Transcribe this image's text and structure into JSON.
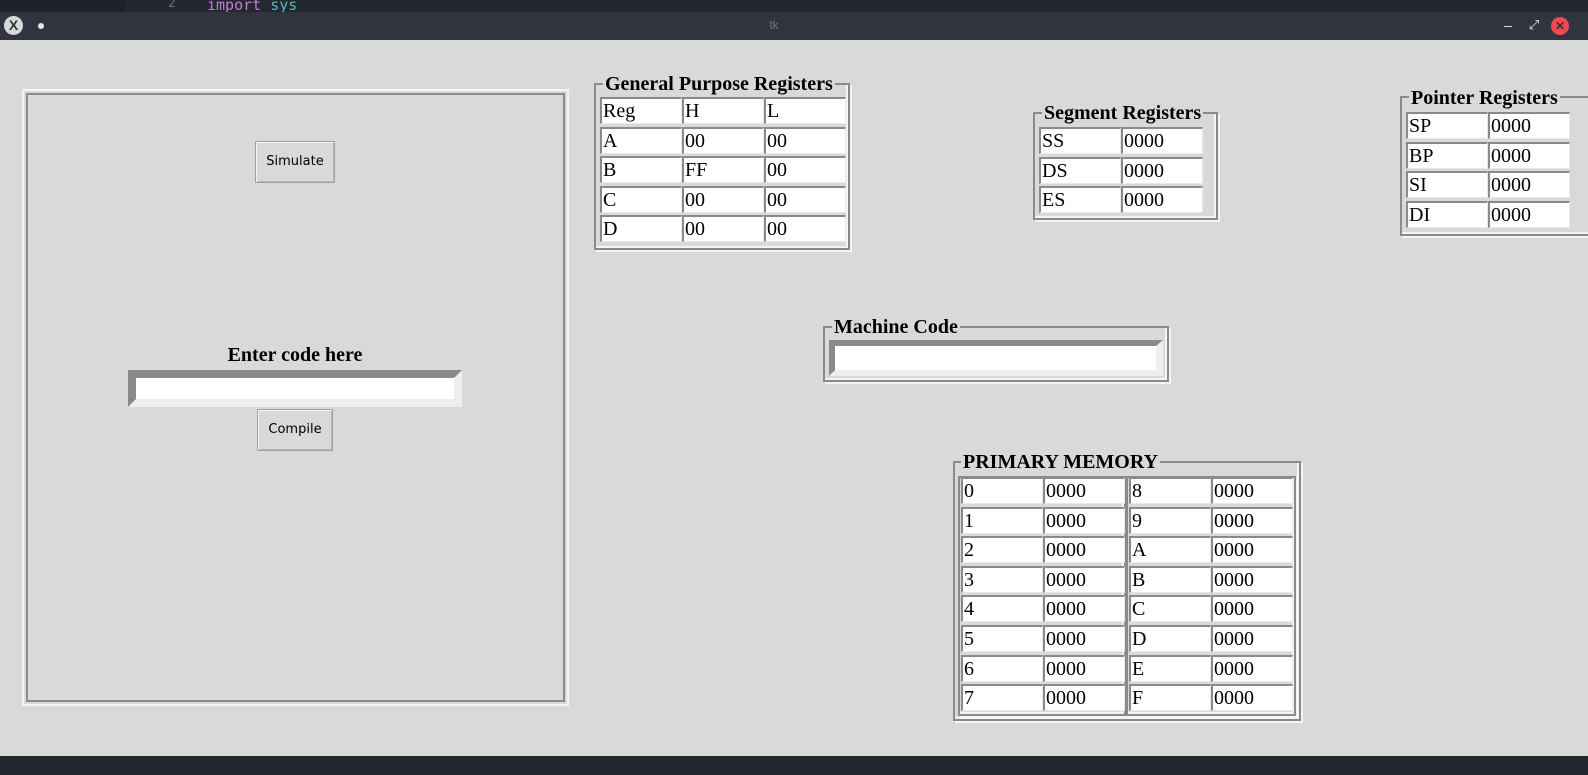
{
  "editor_behind": {
    "line_number": "2",
    "keyword": "import",
    "module": "sys"
  },
  "window": {
    "title": "tk"
  },
  "left_panel": {
    "simulate_label": "Simulate",
    "prompt": "Enter code here",
    "code_value": "",
    "compile_label": "Compile"
  },
  "gpr": {
    "title": "General Purpose Registers",
    "rows": [
      [
        "Reg",
        "H",
        "L"
      ],
      [
        "A",
        "00",
        "00"
      ],
      [
        "B",
        "FF",
        "00"
      ],
      [
        "C",
        "00",
        "00"
      ],
      [
        "D",
        "00",
        "00"
      ]
    ]
  },
  "segment": {
    "title": "Segment Registers",
    "rows": [
      [
        "SS",
        "0000"
      ],
      [
        "DS",
        "0000"
      ],
      [
        "ES",
        "0000"
      ]
    ]
  },
  "pointer": {
    "title": "Pointer Registers",
    "rows": [
      [
        "SP",
        "0000"
      ],
      [
        "BP",
        "0000"
      ],
      [
        "SI",
        "0000"
      ],
      [
        "DI",
        "0000"
      ]
    ]
  },
  "machine_code": {
    "title": "Machine Code",
    "value": ""
  },
  "memory": {
    "title": "PRIMARY MEMORY",
    "left": [
      [
        "0",
        "0000"
      ],
      [
        "1",
        "0000"
      ],
      [
        "2",
        "0000"
      ],
      [
        "3",
        "0000"
      ],
      [
        "4",
        "0000"
      ],
      [
        "5",
        "0000"
      ],
      [
        "6",
        "0000"
      ],
      [
        "7",
        "0000"
      ]
    ],
    "right": [
      [
        "8",
        "0000"
      ],
      [
        "9",
        "0000"
      ],
      [
        "A",
        "0000"
      ],
      [
        "B",
        "0000"
      ],
      [
        "C",
        "0000"
      ],
      [
        "D",
        "0000"
      ],
      [
        "E",
        "0000"
      ],
      [
        "F",
        "0000"
      ]
    ]
  }
}
